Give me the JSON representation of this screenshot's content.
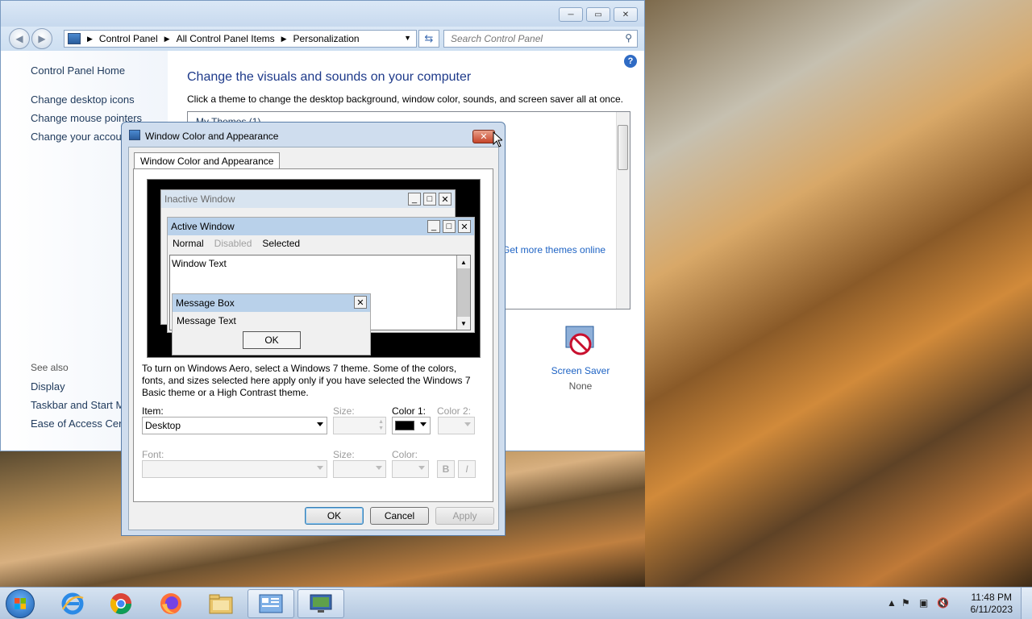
{
  "control_panel": {
    "breadcrumb": [
      "Control Panel",
      "All Control Panel Items",
      "Personalization"
    ],
    "search_placeholder": "Search Control Panel",
    "left_links": [
      "Control Panel Home",
      "Change desktop icons",
      "Change mouse pointers",
      "Change your account picture"
    ],
    "see_also_label": "See also",
    "see_also_links": [
      "Display",
      "Taskbar and Start Menu",
      "Ease of Access Center"
    ],
    "heading": "Change the visuals and sounds on your computer",
    "subtitle": "Click a theme to change the desktop background, window color, sounds, and screen saver all at once.",
    "themes_group": "My Themes (1)",
    "online_link": "Get more themes online",
    "screensaver_label": "Screen Saver",
    "screensaver_value": "None",
    "help_symbol": "?"
  },
  "dialog": {
    "title": "Window Color and Appearance",
    "tab": "Window Color and Appearance",
    "preview": {
      "inactive_title": "Inactive Window",
      "active_title": "Active Window",
      "menu_normal": "Normal",
      "menu_disabled": "Disabled",
      "menu_selected": "Selected",
      "window_text": "Window Text",
      "message_box_title": "Message Box",
      "message_text": "Message Text",
      "message_ok": "OK"
    },
    "explanation": "To turn on Windows Aero, select a Windows 7 theme.  Some of the colors, fonts, and sizes selected here apply only if you have selected the Windows 7 Basic theme or a High Contrast theme.",
    "item_label": "Item:",
    "item_value": "Desktop",
    "size_label": "Size:",
    "color1_label": "Color 1:",
    "color1_value": "#000000",
    "color2_label": "Color 2:",
    "font_label": "Font:",
    "font_size_label": "Size:",
    "font_color_label": "Color:",
    "bold_label": "B",
    "italic_label": "I",
    "ok_label": "OK",
    "cancel_label": "Cancel",
    "apply_label": "Apply"
  },
  "taskbar": {
    "apps": [
      "start-icon",
      "internet-explorer-icon",
      "chrome-icon",
      "firefox-icon",
      "file-explorer-icon",
      "control-panel-icon",
      "display-settings-icon"
    ],
    "time": "11:48 PM",
    "date": "6/11/2023"
  },
  "colors": {
    "title_active": "#b9d1ea",
    "title_inactive": "#d8e4f0",
    "link_blue": "#1e63c4"
  }
}
